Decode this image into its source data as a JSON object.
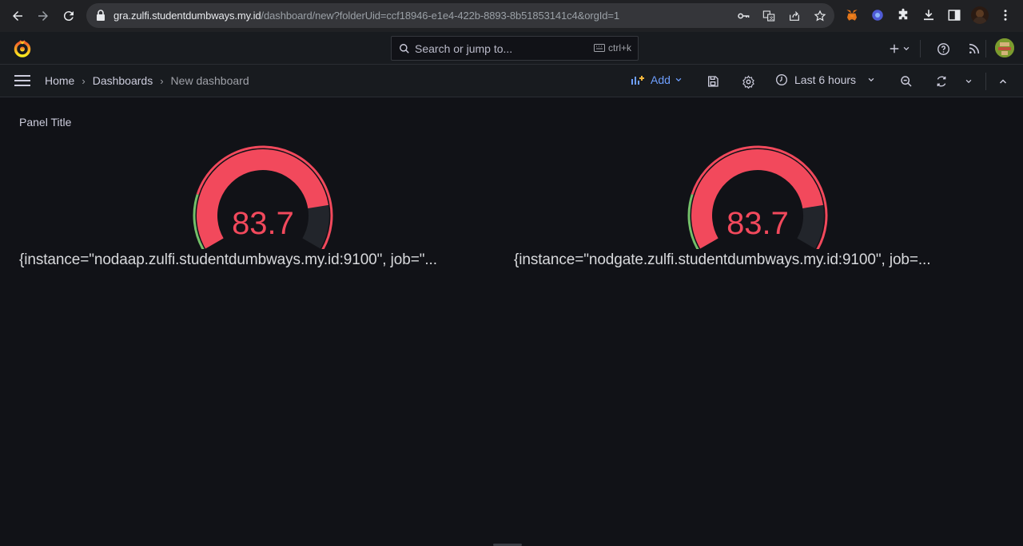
{
  "browser": {
    "url_host": "gra.zulfi.studentdumbways.my.id",
    "url_path": "/dashboard/new?folderUid=ccf18946-e1e4-422b-8893-8b51853141c4&orgId=1"
  },
  "topnav": {
    "search_placeholder": "Search or jump to...",
    "search_shortcut": "ctrl+k"
  },
  "toolbar": {
    "breadcrumbs": [
      "Home",
      "Dashboards",
      "New dashboard"
    ],
    "add_label": "Add",
    "time_range": "Last 6 hours"
  },
  "panel": {
    "title": "Panel Title",
    "gauges": [
      {
        "value_text": "83.7",
        "label": "{instance=\"nodaap.zulfi.studentdumbways.my.id:9100\", job=\"...",
        "percent": 83.7
      },
      {
        "value_text": "83.7",
        "label": "{instance=\"nodgate.zulfi.studentdumbways.my.id:9100\", job=...",
        "percent": 83.7
      }
    ],
    "threshold_color_ok": "#73bf69",
    "threshold_color_alert": "#f2495c",
    "track_color": "#22252b"
  }
}
